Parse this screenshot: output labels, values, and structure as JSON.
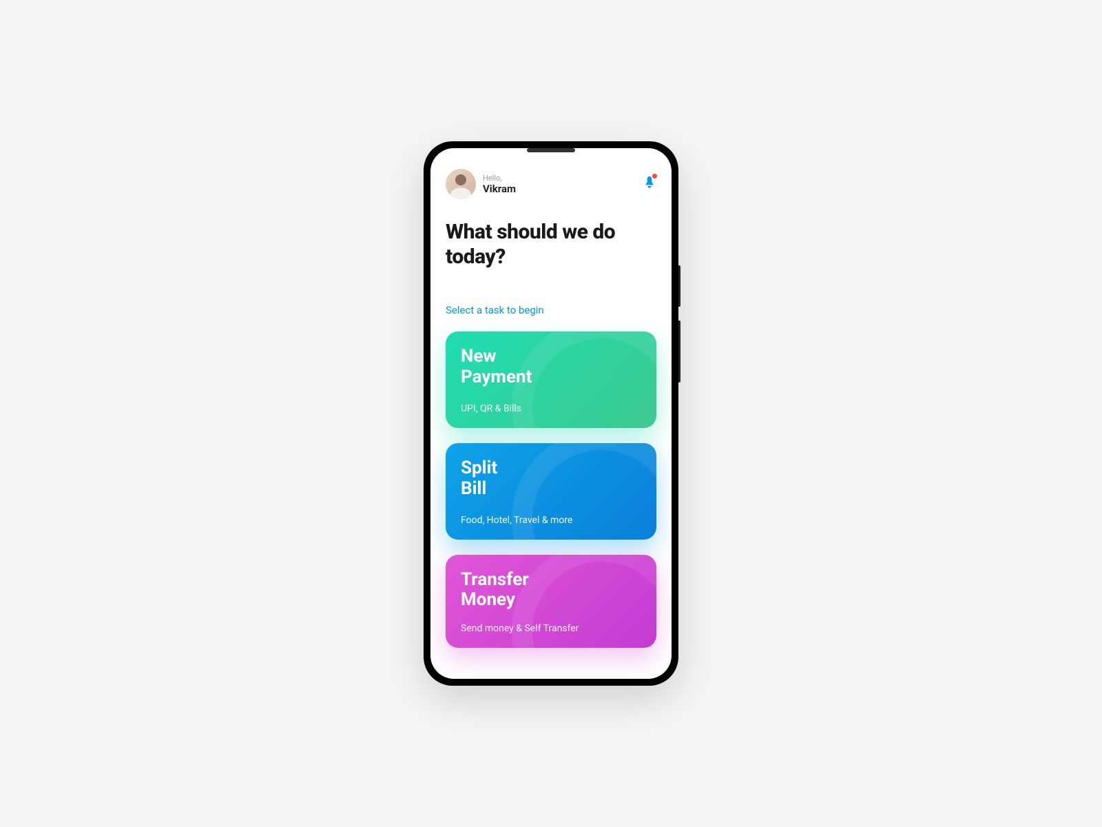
{
  "header": {
    "greeting": "Hello,",
    "username": "Vikram",
    "notification_has_badge": true
  },
  "main": {
    "heading": "What should we do today?",
    "subheading": "Select a task to begin"
  },
  "tasks": [
    {
      "title_line1": "New",
      "title_line2": "Payment",
      "subtitle": "UPI, QR & Bills",
      "color": "green"
    },
    {
      "title_line1": "Split",
      "title_line2": "Bill",
      "subtitle": "Food, Hotel, Travel & more",
      "color": "blue"
    },
    {
      "title_line1": "Transfer",
      "title_line2": "Money",
      "subtitle": "Send money & Self Transfer",
      "color": "pink"
    }
  ]
}
